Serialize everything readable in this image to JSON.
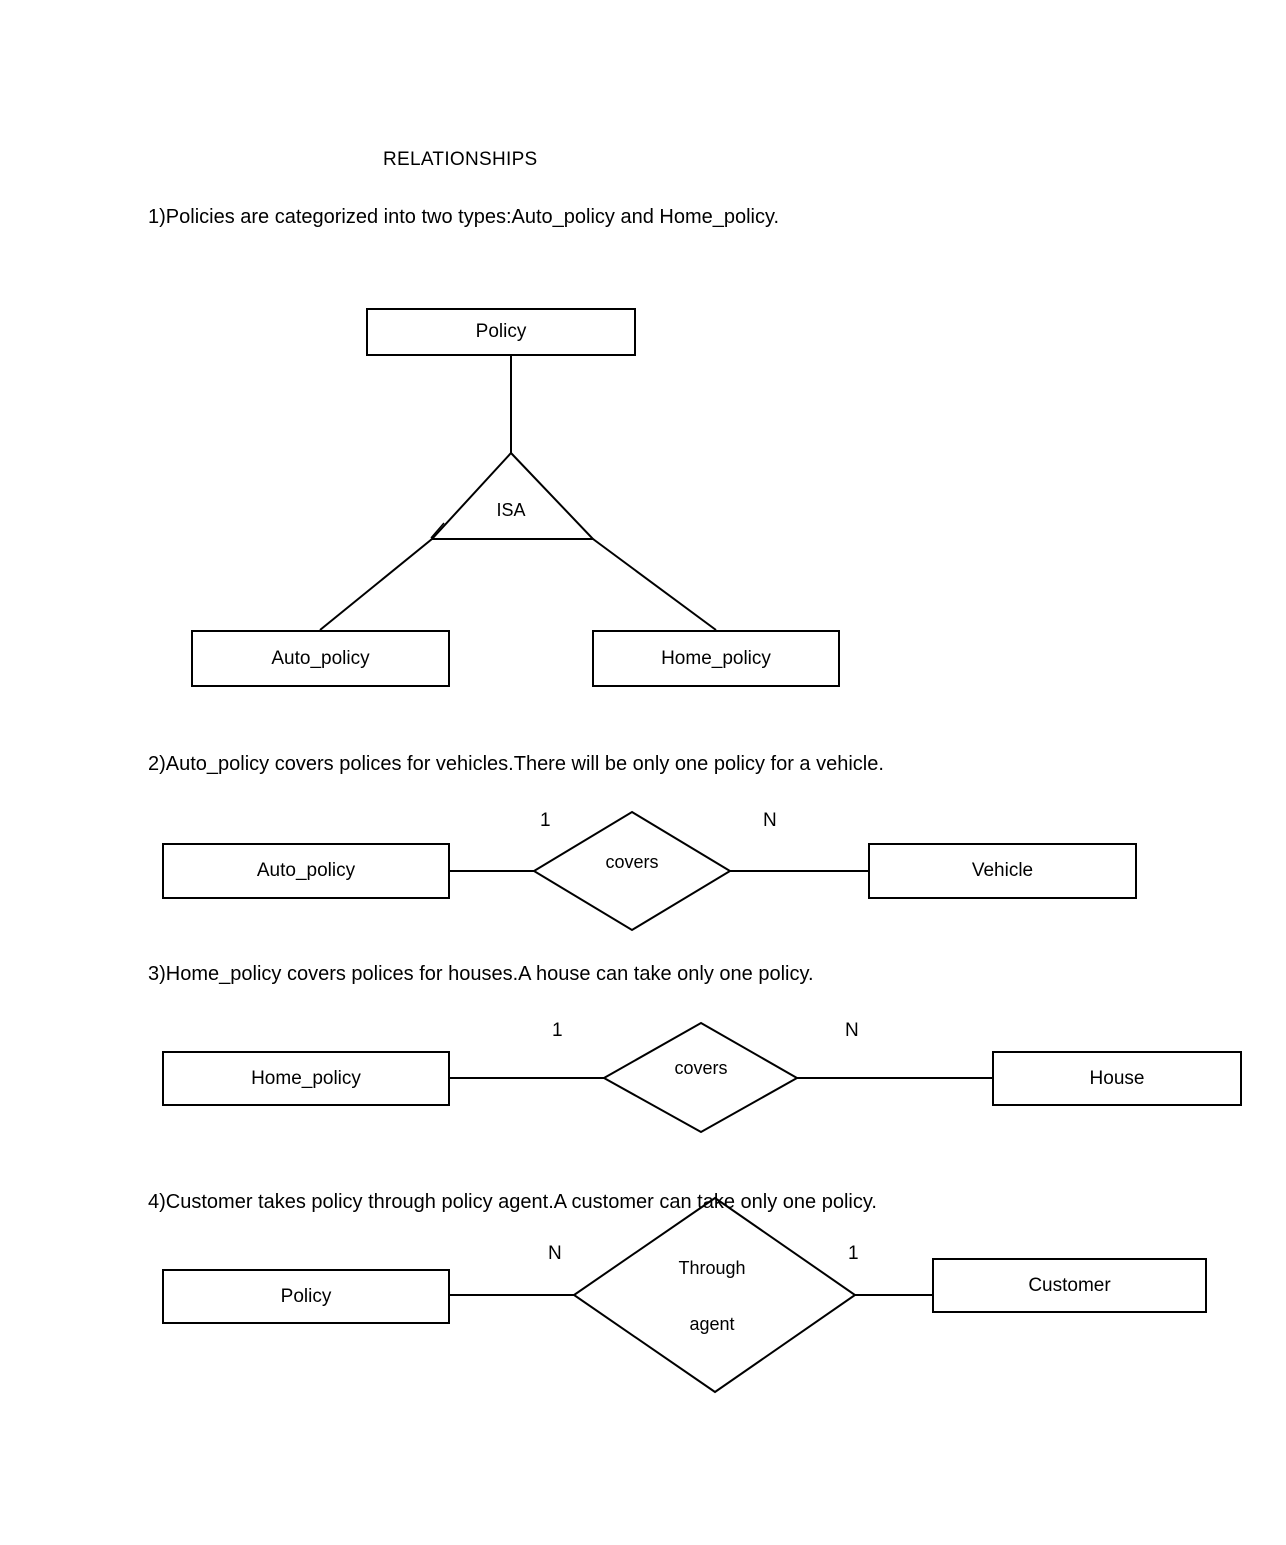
{
  "document": {
    "heading": "RELATIONSHIPS",
    "statements": [
      "1)Policies are categorized into two types:Auto_policy and Home_policy.",
      "2)Auto_policy covers polices for vehicles.There will be only one policy for a vehicle.",
      "3)Home_policy covers polices for houses.A house can take only one policy.",
      "4)Customer takes policy through policy agent.A customer can take only one policy."
    ]
  },
  "colors": {
    "stroke": "#000000",
    "background": "#ffffff",
    "text": "#000000"
  },
  "diagram1": {
    "parent_entity": "Policy",
    "relationship": "ISA",
    "child_left": "Auto_policy",
    "child_right": "Home_policy"
  },
  "diagram2": {
    "left_entity": "Auto_policy",
    "relationship": "covers",
    "right_entity": "Vehicle",
    "left_cardinality": "1",
    "right_cardinality": "N"
  },
  "diagram3": {
    "left_entity": "Home_policy",
    "relationship": "covers",
    "right_entity": "House",
    "left_cardinality": "1",
    "right_cardinality": "N"
  },
  "diagram4": {
    "left_entity": "Policy",
    "relationship_line1": "Through",
    "relationship_line2": "agent",
    "right_entity": "Customer",
    "left_cardinality": "N",
    "right_cardinality": "1"
  }
}
